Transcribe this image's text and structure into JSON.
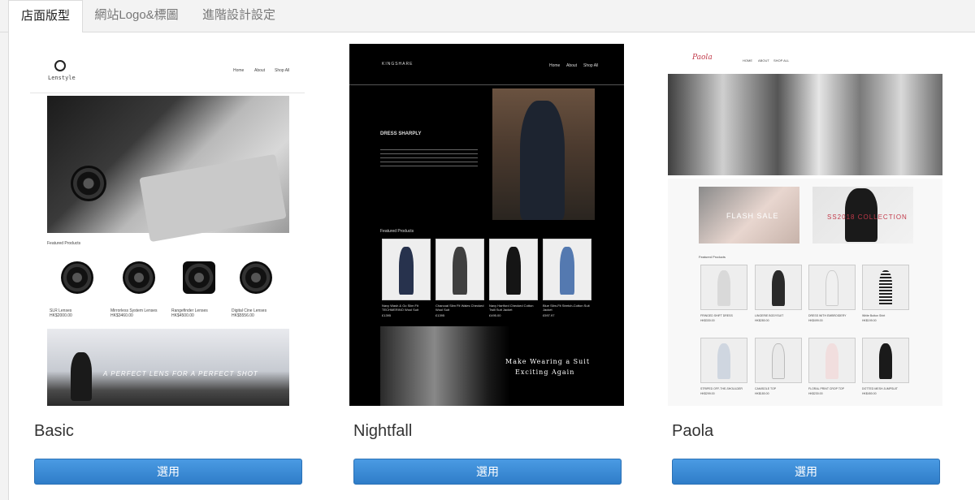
{
  "tabs": [
    "店面版型",
    "網站Logo&標圖",
    "進階設計設定"
  ],
  "select_label": "選用",
  "themes": [
    {
      "name": "Basic",
      "preview": {
        "brand": "Lenstyle",
        "nav": [
          "Home",
          "About",
          "Shop All"
        ],
        "section": "Featured Products",
        "products": [
          {
            "title": "SLR Lenses",
            "price": "HK$2000.00"
          },
          {
            "title": "Mirrorless System Lenses",
            "price": "HK$3460.00"
          },
          {
            "title": "Rangefinder Lenses",
            "price": "HK$4500.00"
          },
          {
            "title": "Digital Cine Lenses",
            "price": "HK$5556.00"
          }
        ],
        "banner": "A PERFECT LENS FOR A PERFECT SHOT"
      }
    },
    {
      "name": "Nightfall",
      "preview": {
        "brand": "KINGSHARE",
        "nav": [
          "Home",
          "About",
          "Shop All"
        ],
        "heading": "DRESS SHARPLY",
        "section": "Featured Products",
        "products": [
          {
            "title": "Navy Wash & Go Slim Fit TECHMERINO Wool Suit",
            "price": "£1395"
          },
          {
            "title": "Charcoal Slim Fit Wales Checked Wool Suit",
            "price": "£1395"
          },
          {
            "title": "Navy Hartford Checked Cotton Twill Suit Jacket",
            "price": "£495.00"
          },
          {
            "title": "Blue Slim-Fit Stretch-Cotton Suit Jacket",
            "price": "£597.97"
          }
        ],
        "banner_line1": "Make Wearing a Suit",
        "banner_line2": "Exciting Again"
      }
    },
    {
      "name": "Paola",
      "preview": {
        "brand": "Paola",
        "nav": [
          "HOME",
          "ABOUT",
          "SHOP ALL"
        ],
        "promo1": "FLASH SALE",
        "promo2": "SS2018 COLLECTION",
        "section": "Featured Products",
        "products": [
          {
            "title": "FRINGED SHIFT DRESS",
            "price": "HK$330.00"
          },
          {
            "title": "LINGERIE BODYSUIT",
            "price": "HK$280.00"
          },
          {
            "title": "DRESS WITH EMBROIDERY",
            "price": "HK$499.00"
          },
          {
            "title": "White Button Shirt",
            "price": "HK$199.00"
          },
          {
            "title": "STRIPED OFF-THE-SHOULDER",
            "price": "HK$299.00"
          },
          {
            "title": "CAMISOLE TOP",
            "price": "HK$180.00"
          },
          {
            "title": "FLORAL PRINT CROP TOP",
            "price": "HK$230.00"
          },
          {
            "title": "DOTTED MESH JUMPSUIT",
            "price": "HK$450.00"
          }
        ]
      }
    }
  ],
  "colors": {
    "button": "#3a8ad6",
    "nightfall_bg": "#000000",
    "tab_border": "#dcdcdc"
  }
}
